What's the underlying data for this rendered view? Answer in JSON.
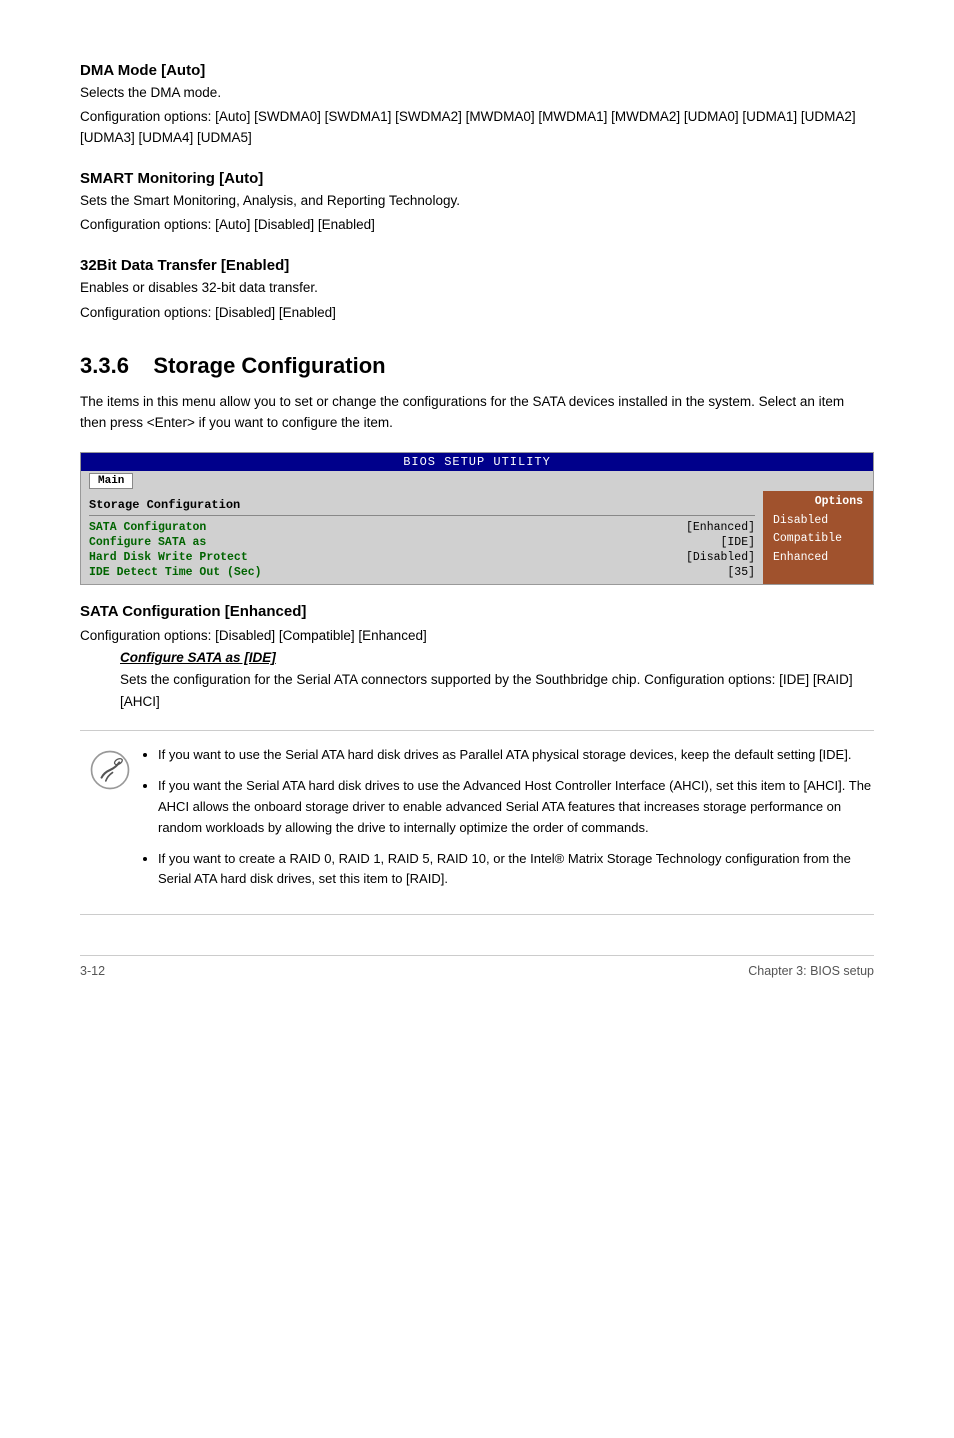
{
  "sections": [
    {
      "id": "dma-mode",
      "heading": "DMA Mode [Auto]",
      "lines": [
        "Selects the DMA mode.",
        "Configuration options: [Auto] [SWDMA0] [SWDMA1] [SWDMA2] [MWDMA0] [MWDMA1] [MWDMA2] [UDMA0] [UDMA1] [UDMA2] [UDMA3] [UDMA4] [UDMA5]"
      ]
    },
    {
      "id": "smart-monitoring",
      "heading": "SMART Monitoring [Auto]",
      "lines": [
        "Sets the Smart Monitoring, Analysis, and Reporting Technology.",
        "Configuration options: [Auto] [Disabled] [Enabled]"
      ]
    },
    {
      "id": "32bit-transfer",
      "heading": "32Bit Data Transfer [Enabled]",
      "lines": [
        "Enables or disables 32-bit data transfer.",
        "Configuration options: [Disabled] [Enabled]"
      ]
    }
  ],
  "chapter_section": {
    "number": "3.3.6",
    "title": "Storage Configuration",
    "intro": "The items in this menu allow you to set or change the configurations for the SATA devices installed in the system. Select an item then press <Enter> if you want to configure the item."
  },
  "bios": {
    "title": "BIOS SETUP UTILITY",
    "nav_item": "Main",
    "section_title": "Storage Configuration",
    "rows": [
      {
        "label": "SATA Configuraton",
        "value": "[Enhanced]"
      },
      {
        "label": " Configure SATA as",
        "value": "[IDE]"
      },
      {
        "label": "Hard Disk Write Protect",
        "value": "[Disabled]"
      },
      {
        "label": "IDE Detect Time Out (Sec)",
        "value": "[35]"
      }
    ],
    "options_title": "Options",
    "options": [
      "Disabled",
      "Compatible",
      "Enhanced"
    ]
  },
  "sata_config": {
    "heading": "SATA Configuration [Enhanced]",
    "config_options": "Configuration options: [Disabled] [Compatible] [Enhanced]",
    "sub_heading": "Configure SATA as [IDE]",
    "sub_text": "Sets the configuration for the Serial ATA connectors supported by the Southbridge chip. Configuration options: [IDE] [RAID] [AHCI]"
  },
  "notes": [
    "If you want to use the Serial ATA hard disk drives as Parallel ATA physical storage devices, keep the default setting [IDE].",
    "If you want the Serial ATA hard disk drives to use the Advanced Host Controller Interface (AHCI), set this item to [AHCI]. The AHCI allows the onboard storage driver to enable advanced Serial ATA features that increases storage performance on random workloads by allowing the drive to internally optimize the order of commands.",
    "If you want to create a RAID 0, RAID 1, RAID 5, RAID 10, or the Intel® Matrix Storage Technology configuration from the Serial ATA hard disk drives, set this item to [RAID]."
  ],
  "footer": {
    "left": "3-12",
    "right": "Chapter 3: BIOS setup"
  }
}
